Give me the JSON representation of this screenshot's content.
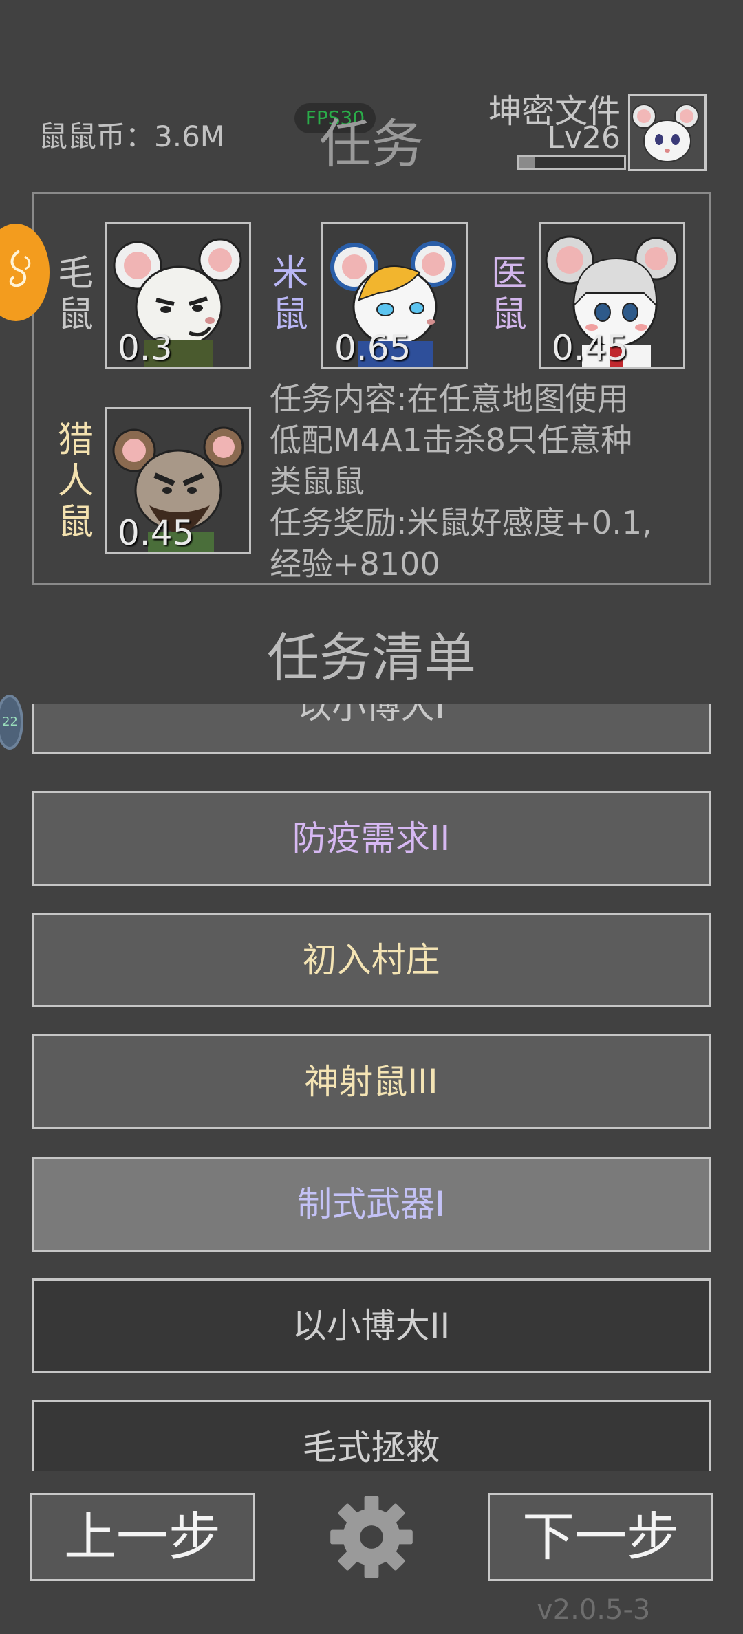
{
  "header": {
    "coins_label": "鼠鼠币：3.6M",
    "fps": "FPS30",
    "title": "任务",
    "profile_name": "坤密文件",
    "profile_level": "Lv26",
    "xp_progress": 0.15
  },
  "characters": [
    {
      "name": "毛鼠",
      "char1": "毛",
      "char2": "鼠",
      "value": "0.3",
      "name_color": "#c8c8c8"
    },
    {
      "name": "米鼠",
      "char1": "米",
      "char2": "鼠",
      "value": "0.65",
      "name_color": "#b9b6f4"
    },
    {
      "name": "医鼠",
      "char1": "医",
      "char2": "鼠",
      "value": "0.45",
      "name_color": "#d3b6ec"
    },
    {
      "name": "猎人鼠",
      "char1": "猎",
      "char2": "人",
      "char3": "鼠",
      "value": "0.45",
      "name_color": "#f4e2b0"
    }
  ],
  "mission_detail": {
    "line1": "任务内容:在任意地图使用",
    "line2": "低配M4A1击杀8只任意种",
    "line3": "类鼠鼠",
    "line4": "任务奖励:米鼠好感度+0.1,",
    "line5": "经验+8100"
  },
  "side_badge": "22",
  "list_title": "任务清单",
  "missions": [
    {
      "label": "以小博大I",
      "color": "#c8c8c8",
      "style": "gray"
    },
    {
      "label": "防疫需求II",
      "color": "#d6b8f2",
      "style": "gray"
    },
    {
      "label": "初入村庄",
      "color": "#f4e4b4",
      "style": "gray"
    },
    {
      "label": "神射鼠III",
      "color": "#f4e4b4",
      "style": "gray"
    },
    {
      "label": "制式武器I",
      "color": "#c4c2f6",
      "style": "highlighted"
    },
    {
      "label": "以小博大II",
      "color": "#d0d0d0",
      "style": "dark"
    },
    {
      "label": "毛式拯救",
      "color": "#d0d0d0",
      "style": "dark"
    }
  ],
  "footer": {
    "prev_label": "上一步",
    "next_label": "下一步",
    "version": "v2.0.5-3"
  }
}
